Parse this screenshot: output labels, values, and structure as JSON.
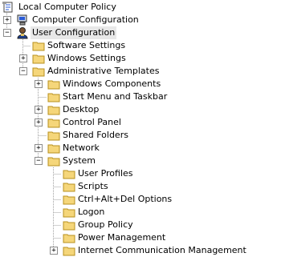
{
  "tree": {
    "root": {
      "label": "Local Computer Policy",
      "icon": "policy-scroll-icon"
    },
    "computer_config": {
      "label": "Computer Configuration",
      "icon": "computer-icon",
      "expander": "+"
    },
    "user_config": {
      "label": "User Configuration",
      "icon": "user-icon",
      "expander": "−"
    },
    "software_settings": {
      "label": "Software Settings",
      "icon": "folder-icon"
    },
    "windows_settings": {
      "label": "Windows Settings",
      "icon": "folder-icon",
      "expander": "+"
    },
    "admin_templates": {
      "label": "Administrative Templates",
      "icon": "folder-icon",
      "expander": "−"
    },
    "windows_components": {
      "label": "Windows Components",
      "icon": "folder-icon",
      "expander": "+"
    },
    "start_menu": {
      "label": "Start Menu and Taskbar",
      "icon": "folder-icon"
    },
    "desktop": {
      "label": "Desktop",
      "icon": "folder-icon",
      "expander": "+"
    },
    "control_panel": {
      "label": "Control Panel",
      "icon": "folder-icon",
      "expander": "+"
    },
    "shared_folders": {
      "label": "Shared Folders",
      "icon": "folder-icon"
    },
    "network": {
      "label": "Network",
      "icon": "folder-icon",
      "expander": "+"
    },
    "system": {
      "label": "System",
      "icon": "folder-icon",
      "expander": "−"
    },
    "user_profiles": {
      "label": "User Profiles",
      "icon": "folder-icon"
    },
    "scripts": {
      "label": "Scripts",
      "icon": "folder-icon"
    },
    "ctrl_alt_del": {
      "label": "Ctrl+Alt+Del Options",
      "icon": "folder-icon"
    },
    "logon": {
      "label": "Logon",
      "icon": "folder-icon"
    },
    "group_policy": {
      "label": "Group Policy",
      "icon": "folder-icon"
    },
    "power_management": {
      "label": "Power Management",
      "icon": "folder-icon"
    },
    "internet_comm_mgmt": {
      "label": "Internet Communication Management",
      "icon": "folder-icon",
      "expander": "+"
    }
  },
  "colors": {
    "folder_fill": "#f5d67a",
    "folder_edge": "#b8901f",
    "tree_line": "#a0a0a0",
    "selection": "#e8e8e8"
  }
}
